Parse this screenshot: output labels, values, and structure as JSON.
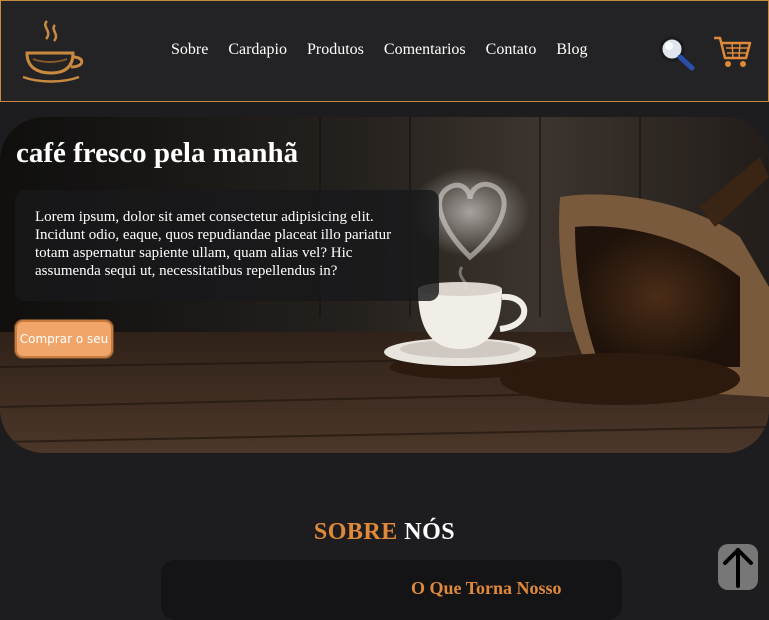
{
  "nav": {
    "links": [
      "Sobre",
      "Cardapio",
      "Produtos",
      "Comentarios",
      "Contato",
      "Blog"
    ]
  },
  "icons": {
    "logo": "coffee-cup-logo",
    "search": "magnifier-icon",
    "cart": "shopping-cart-icon",
    "back_to_top": "arrow-up-icon"
  },
  "hero": {
    "title": "café fresco pela manhã",
    "text": "Lorem ipsum, dolor sit amet consectetur adipisicing elit. Incidunt odio, eaque, quos repudiandae placeat illo pariatur totam aspernatur sapiente ullam, quam alias vel? Hic assumenda sequi ut, necessitatibus repellendus in?",
    "button": "Comprar o seu"
  },
  "about": {
    "title_accent": "SOBRE",
    "title_rest": "NÓS",
    "card_title": "O Que Torna Nosso"
  },
  "colors": {
    "accent": "#e0893b",
    "background": "#1d1d1f",
    "button": "#f0a56a"
  }
}
